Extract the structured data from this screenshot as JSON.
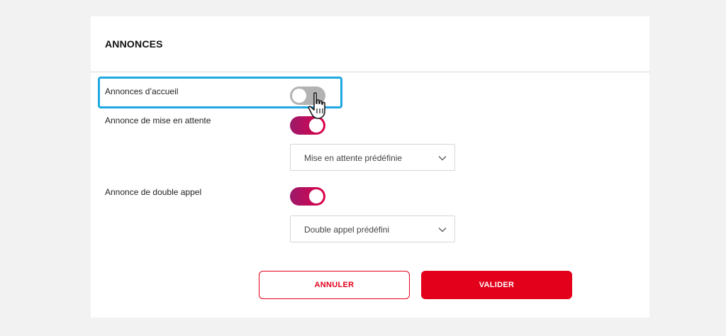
{
  "panel": {
    "title": "ANNONCES"
  },
  "settings": [
    {
      "label": "Annonces d’accueil",
      "enabled": false
    },
    {
      "label": "Annonce de mise en attente",
      "enabled": true,
      "select_value": "Mise en attente prédéfinie"
    },
    {
      "label": "Annonce de double appel",
      "enabled": true,
      "select_value": "Double appel prédéfini"
    }
  ],
  "actions": {
    "cancel_label": "ANNULER",
    "confirm_label": "VALIDER"
  },
  "colors": {
    "accent": "#e2001a",
    "toggle_on_start": "#9b1a6a",
    "toggle_on_end": "#e0004a",
    "toggle_off": "#b3b3b3",
    "highlight": "#20a9e0"
  },
  "icons": {
    "select_arrow": "chevron-down-icon",
    "pointer": "hand-pointer-icon"
  }
}
